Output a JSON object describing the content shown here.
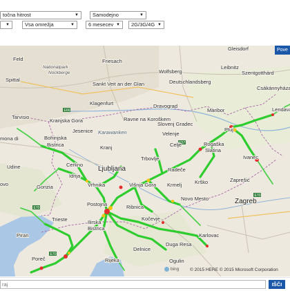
{
  "controls": {
    "row1": {
      "speed_select": "točna hitrost",
      "refresh_select": "Samodejno"
    },
    "row2": {
      "empty_select": "",
      "network_select": "Vsa omrežja",
      "period_select": "6 mesecev",
      "tech_select": "2G/3G/4G"
    }
  },
  "map": {
    "power_button": "Pove",
    "copyright": "© 2015 HERE © 2015 Microsoft Corporation",
    "bing_label": "bing",
    "colors": {
      "good": "#2ecc2e",
      "medium": "#f1c40f",
      "poor": "#e52d2d",
      "accent": "#1b57a8",
      "bg": "#ece8dd"
    },
    "places": {
      "feld": "Feld",
      "gleisdorf": "Gleisdorf",
      "friesach": "Friesach",
      "nationalpark": "Nationalpark",
      "nockberge": "Nockberge",
      "wolfsberg": "Wolfsberg",
      "leibnitz": "Leibnitz",
      "spittal": "Spittal",
      "stveit": "Sankt Veit an der Glan",
      "deutschlandsberg": "Deutschlandsberg",
      "csakanyh": "Csákánnyháza",
      "szentgotthard": "Szentgotthárd",
      "lendava": "Lendava",
      "klagenfurt": "Klagenfurt",
      "dravograd": "Dravograd",
      "maribor": "Maribor",
      "tarvisio": "Tarvisio",
      "kranjskagora": "Kranjska Gora",
      "ravne": "Ravne na Koroškem",
      "slovenjgradec": "Slovenj Gradec",
      "ptuj": "Ptuj",
      "jesenice": "Jesenice",
      "karawanken": "Karawanken",
      "velenje": "Velenje",
      "monadi": "mona di",
      "bohinjska": "Bohinjska",
      "bistrica": "Bistrica",
      "kranj": "Kranj",
      "celje": "Celje",
      "rogaska": "Rogaška",
      "slatina": "Slatina",
      "ivanec": "Ivanec",
      "trbovlje": "Trbovlje",
      "cerkno": "Cerkno",
      "ljubljana": "Ljubljana",
      "udine": "Udine",
      "idrija": "Idrija",
      "radece": "Radeče",
      "krsko": "Krško",
      "zapresic": "Zaprešić",
      "ovo": "ovo",
      "vrhnika": "Vrhnika",
      "visnjagora": "Višnja Gora",
      "krmelj": "Krmelj",
      "gorizia": "Gorizia",
      "novomesto": "Novo Mesto",
      "zagreb": "Zagreb",
      "postojna": "Postojna",
      "ribnica": "Ribnica",
      "trieste": "Trieste",
      "ilirska": "Ilirska",
      "bistrica2": "Bistrica",
      "kocevje": "Kočevje",
      "karlovac": "Karlovac",
      "piran": "Piran",
      "delnice": "Delnice",
      "dugaresa": "Duga Resa",
      "porec": "Poreč",
      "rijeka": "Rijeka",
      "ogulin": "Ogulin"
    }
  },
  "search": {
    "placeholder": "raj",
    "button": "IŠČI"
  }
}
